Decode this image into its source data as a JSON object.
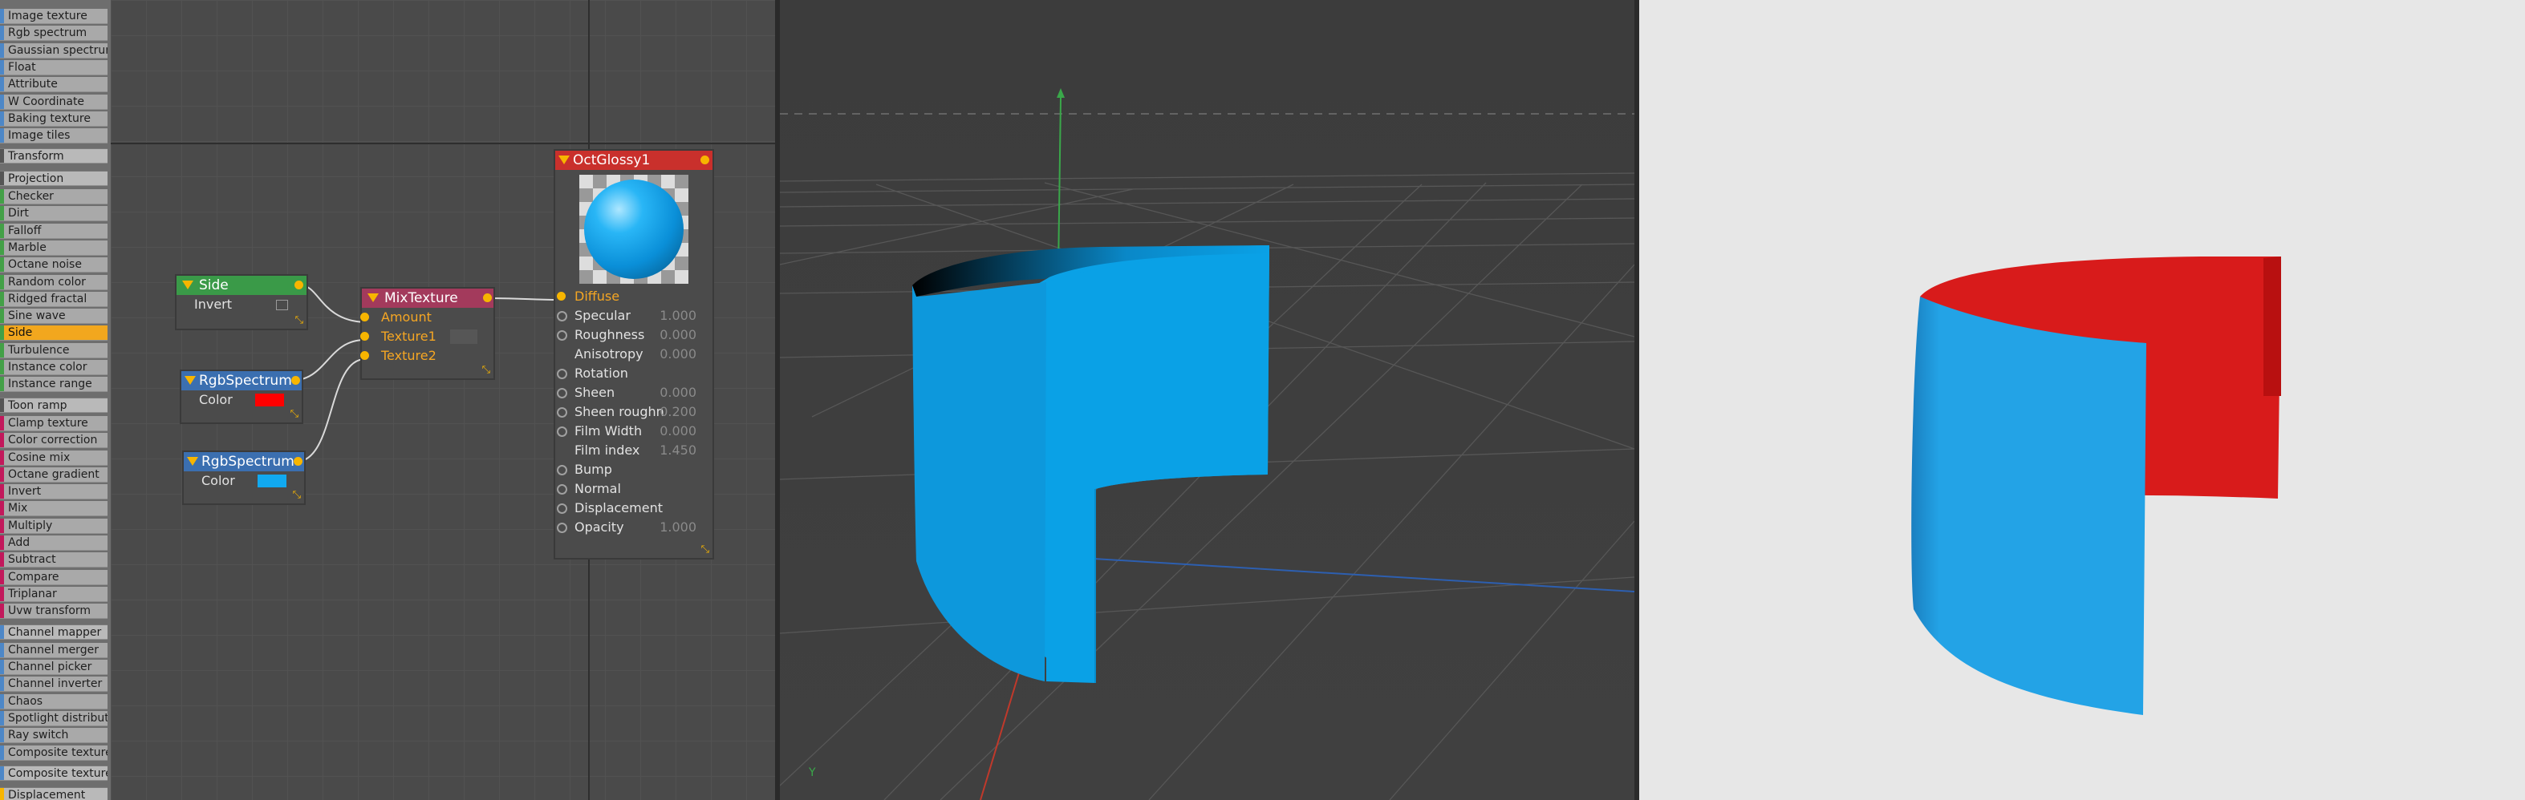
{
  "node_list": {
    "items": [
      {
        "label": "Image texture",
        "kind": "item",
        "color": "#4d87c7"
      },
      {
        "label": "Rgb spectrum",
        "kind": "item",
        "color": "#4d87c7"
      },
      {
        "label": "Gaussian spectrum",
        "kind": "item",
        "color": "#4d87c7"
      },
      {
        "label": "Float",
        "kind": "item",
        "color": "#4d87c7"
      },
      {
        "label": "Attribute",
        "kind": "item",
        "color": "#4d87c7"
      },
      {
        "label": "W Coordinate",
        "kind": "item",
        "color": "#4d87c7"
      },
      {
        "label": "Baking texture",
        "kind": "item",
        "color": "#4d87c7"
      },
      {
        "label": "Image tiles",
        "kind": "item",
        "color": "#4d87c7"
      },
      {
        "label": "Transform",
        "kind": "cat",
        "color": "#555555"
      },
      {
        "label": "Projection",
        "kind": "cat",
        "color": "#555555"
      },
      {
        "label": "Checker",
        "kind": "item",
        "color": "#43a047"
      },
      {
        "label": "Dirt",
        "kind": "item",
        "color": "#43a047"
      },
      {
        "label": "Falloff",
        "kind": "item",
        "color": "#43a047"
      },
      {
        "label": "Marble",
        "kind": "item",
        "color": "#43a047"
      },
      {
        "label": "Octane noise",
        "kind": "item",
        "color": "#43a047"
      },
      {
        "label": "Random color",
        "kind": "item",
        "color": "#43a047"
      },
      {
        "label": "Ridged fractal",
        "kind": "item",
        "color": "#43a047"
      },
      {
        "label": "Sine wave",
        "kind": "item",
        "color": "#43a047"
      },
      {
        "label": "Side",
        "kind": "selected",
        "color": "#43a047"
      },
      {
        "label": "Turbulence",
        "kind": "item",
        "color": "#43a047"
      },
      {
        "label": "Instance color",
        "kind": "item",
        "color": "#43a047"
      },
      {
        "label": "Instance range",
        "kind": "item",
        "color": "#43a047"
      },
      {
        "label": "Toon ramp",
        "kind": "cat",
        "color": "#555555"
      },
      {
        "label": "Clamp texture",
        "kind": "item",
        "color": "#c2185b"
      },
      {
        "label": "Color correction",
        "kind": "item",
        "color": "#c2185b"
      },
      {
        "label": "Cosine mix",
        "kind": "item",
        "color": "#c2185b"
      },
      {
        "label": "Octane gradient",
        "kind": "item",
        "color": "#c2185b"
      },
      {
        "label": "Invert",
        "kind": "item",
        "color": "#c2185b"
      },
      {
        "label": "Mix",
        "kind": "item",
        "color": "#c2185b"
      },
      {
        "label": "Multiply",
        "kind": "item",
        "color": "#c2185b"
      },
      {
        "label": "Add",
        "kind": "item",
        "color": "#c2185b"
      },
      {
        "label": "Subtract",
        "kind": "item",
        "color": "#c2185b"
      },
      {
        "label": "Compare",
        "kind": "item",
        "color": "#c2185b"
      },
      {
        "label": "Triplanar",
        "kind": "item",
        "color": "#c2185b"
      },
      {
        "label": "Uvw transform",
        "kind": "item",
        "color": "#c2185b"
      },
      {
        "label": "Channel mapper",
        "kind": "cat",
        "color": "#4d87c7"
      },
      {
        "label": "Channel merger",
        "kind": "item",
        "color": "#4d87c7"
      },
      {
        "label": "Channel picker",
        "kind": "item",
        "color": "#4d87c7"
      },
      {
        "label": "Channel inverter",
        "kind": "item",
        "color": "#4d87c7"
      },
      {
        "label": "Chaos",
        "kind": "item",
        "color": "#4d87c7"
      },
      {
        "label": "Spotlight distributio",
        "kind": "item",
        "color": "#4d87c7"
      },
      {
        "label": "Ray switch",
        "kind": "item",
        "color": "#4d87c7"
      },
      {
        "label": "Composite texture",
        "kind": "item",
        "color": "#4d87c7"
      },
      {
        "label": "Composite texture l",
        "kind": "cat",
        "color": "#4d87c7"
      },
      {
        "label": "Displacement",
        "kind": "cat",
        "color": "#f7b500"
      }
    ]
  },
  "nodes": {
    "side": {
      "title": "Side",
      "header_color": "#3a9a48",
      "rows": [
        {
          "label": "Invert"
        }
      ]
    },
    "rgb1": {
      "title": "RgbSpectrum",
      "header_color": "#3b6fb0",
      "color_label": "Color",
      "swatch": "#ff0000"
    },
    "rgb2": {
      "title": "RgbSpectrum",
      "header_color": "#3b6fb0",
      "color_label": "Color",
      "swatch": "#11a9f0"
    },
    "mix": {
      "title": "MixTexture",
      "header_color": "#a33a5c",
      "rows": [
        "Amount",
        "Texture1",
        "Texture2"
      ]
    },
    "glossy": {
      "title": "OctGlossy1",
      "header_color": "#c9302c",
      "rows": [
        {
          "label": "Diffuse",
          "value": "",
          "port": "filled",
          "orange": true
        },
        {
          "label": "Specular",
          "value": "1.000",
          "port": "empty"
        },
        {
          "label": "Roughness",
          "value": "0.000",
          "port": "empty"
        },
        {
          "label": "Anisotropy",
          "value": "0.000",
          "port": "none"
        },
        {
          "label": "Rotation",
          "value": "",
          "port": "empty"
        },
        {
          "label": "Sheen",
          "value": "0.000",
          "port": "empty"
        },
        {
          "label": "Sheen roughn",
          "value": "0.200",
          "port": "empty"
        },
        {
          "label": "Film Width",
          "value": "0.000",
          "port": "empty"
        },
        {
          "label": "Film index",
          "value": "1.450",
          "port": "none"
        },
        {
          "label": "Bump",
          "value": "",
          "port": "empty"
        },
        {
          "label": "Normal",
          "value": "",
          "port": "empty"
        },
        {
          "label": "Displacement",
          "value": "",
          "port": "empty"
        },
        {
          "label": "Opacity",
          "value": "1.000",
          "port": "empty"
        }
      ]
    }
  },
  "viewport": {
    "axis_label_y": "Y",
    "object_color": "#0aa1e6",
    "grid_color": "#5a5a5a"
  },
  "render": {
    "outer_color": "#23a3e6",
    "inner_color": "#d81b1b"
  },
  "colors": {
    "accent": "#f7b500"
  }
}
